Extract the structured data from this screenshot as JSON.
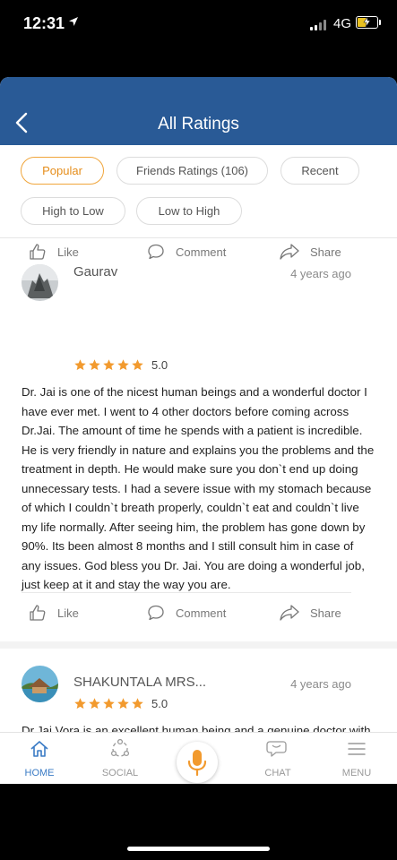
{
  "status_bar": {
    "time": "12:31",
    "network": "4G"
  },
  "header": {
    "title": "All Ratings"
  },
  "filters": [
    {
      "label": "Popular",
      "active": true
    },
    {
      "label": "Friends Ratings (106)",
      "active": false
    },
    {
      "label": "Recent",
      "active": false
    },
    {
      "label": "High to Low",
      "active": false
    },
    {
      "label": "Low to High",
      "active": false
    }
  ],
  "actions": {
    "like": "Like",
    "comment": "Comment",
    "share": "Share"
  },
  "reviews": [
    {
      "name": "Gaurav",
      "time": "4 years ago",
      "rating": "5.0",
      "text": "Dr. Jai is one of the nicest human beings and a wonderful doctor I have ever met. I went to 4 other doctors before coming across Dr.Jai. The amount of time he spends with a patient is incredible. He is very friendly in nature and explains you the problems and the treatment in depth. He would make sure you don`t end up doing unnecessary tests. I had a severe issue with my stomach because of which I couldn`t breath properly, couldn`t eat and couldn`t live my life normally. After seeing him, the problem has gone down by 90%. Its been almost 8 months and I still consult him in case of any issues. God bless you Dr. Jai. You are doing a wonderful job, just keep at it and stay the way you are."
    },
    {
      "name": "SHAKUNTALA MRS...",
      "time": "4 years ago",
      "rating": "5.0",
      "text": "Dr.Jai Vora is an excellent human being and a genuine doctor with integrity. He is one of the few honest doctors remaining with the patients interest primarily on his mind. He gives his valuable time explaining every aspect of the treatment to his patients which makes it easy for the patient to understand his/her condition better. I'm finally satisfied that I have"
    }
  ],
  "tab_bar": {
    "home": "HOME",
    "social": "SOCIAL",
    "chat": "CHAT",
    "menu": "MENU"
  },
  "colors": {
    "nav_bar": "#295a96",
    "accent_orange": "#f0a53b",
    "star": "#f29a2e",
    "tab_active": "#3a7bc5",
    "mic": "#f29a2e"
  }
}
